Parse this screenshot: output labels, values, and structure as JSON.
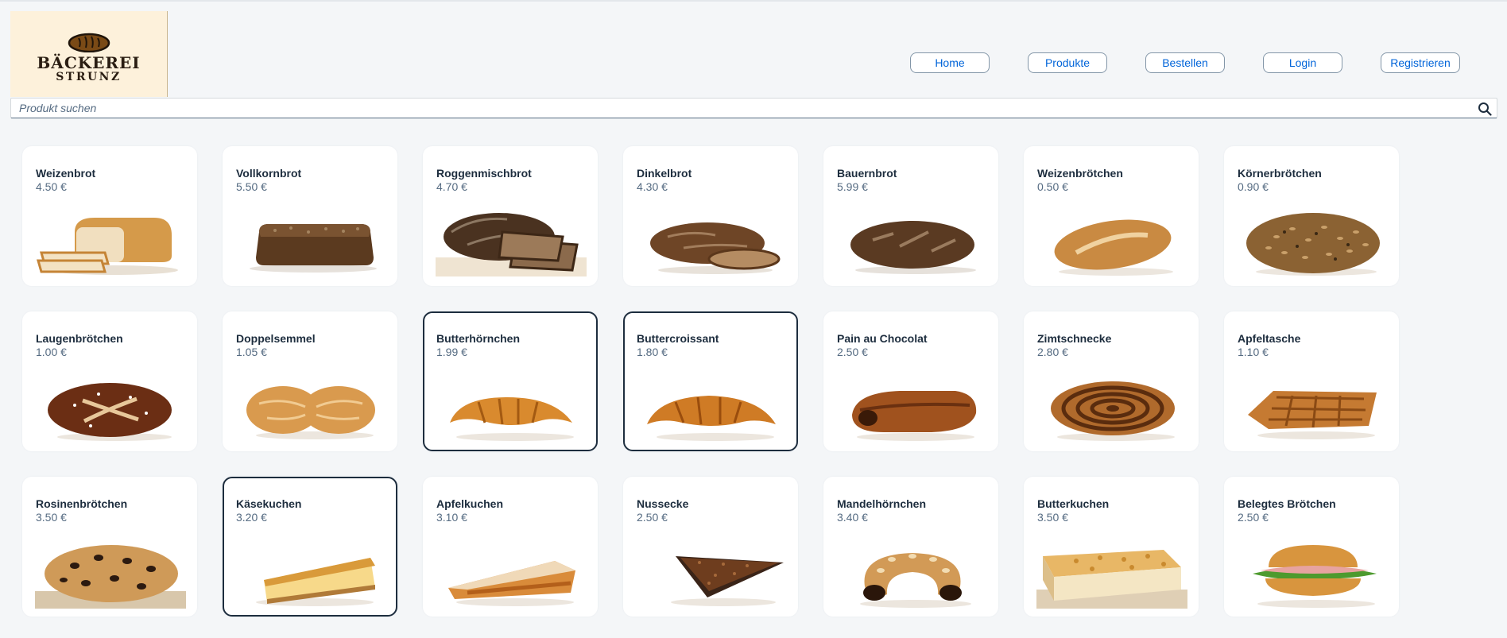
{
  "brand": {
    "line1": "BÄCKEREI",
    "line2": "STRUNZ"
  },
  "nav": [
    {
      "label": "Home"
    },
    {
      "label": "Produkte"
    },
    {
      "label": "Bestellen"
    },
    {
      "label": "Login"
    },
    {
      "label": "Registrieren"
    }
  ],
  "search": {
    "placeholder": "Produkt suchen",
    "icon": "search-icon"
  },
  "products": [
    {
      "name": "Weizenbrot",
      "price": "4.50 €",
      "image": "sliced-white-bread"
    },
    {
      "name": "Vollkornbrot",
      "price": "5.50 €",
      "image": "wholegrain-loaf"
    },
    {
      "name": "Roggenmischbrot",
      "price": "4.70 €",
      "image": "rye-bread"
    },
    {
      "name": "Dinkelbrot",
      "price": "4.30 €",
      "image": "spelt-bread"
    },
    {
      "name": "Bauernbrot",
      "price": "5.99 €",
      "image": "farmer-bread"
    },
    {
      "name": "Weizenbrötchen",
      "price": "0.50 €",
      "image": "wheat-roll"
    },
    {
      "name": "Körnerbrötchen",
      "price": "0.90 €",
      "image": "seed-roll"
    },
    {
      "name": "Laugenbrötchen",
      "price": "1.00 €",
      "image": "pretzel-roll"
    },
    {
      "name": "Doppelsemmel",
      "price": "1.05 €",
      "image": "double-roll"
    },
    {
      "name": "Butterhörnchen",
      "price": "1.99 €",
      "image": "croissant",
      "selected": true
    },
    {
      "name": "Buttercroissant",
      "price": "1.80 €",
      "image": "croissant",
      "selected": true
    },
    {
      "name": "Pain au Chocolat",
      "price": "2.50 €",
      "image": "pain-au-chocolat"
    },
    {
      "name": "Zimtschnecke",
      "price": "2.80 €",
      "image": "cinnamon-roll"
    },
    {
      "name": "Apfeltasche",
      "price": "1.10 €",
      "image": "apple-turnover"
    },
    {
      "name": "Rosinenbrötchen",
      "price": "3.50 €",
      "image": "raisin-roll"
    },
    {
      "name": "Käsekuchen",
      "price": "3.20 €",
      "image": "cheesecake",
      "selected": true
    },
    {
      "name": "Apfelkuchen",
      "price": "3.10 €",
      "image": "apple-cake"
    },
    {
      "name": "Nussecke",
      "price": "2.50 €",
      "image": "nut-corner"
    },
    {
      "name": "Mandelhörnchen",
      "price": "3.40 €",
      "image": "almond-horn"
    },
    {
      "name": "Butterkuchen",
      "price": "3.50 €",
      "image": "butter-cake"
    },
    {
      "name": "Belegtes Brötchen",
      "price": "2.50 €",
      "image": "sandwich"
    }
  ],
  "colors": {
    "accent": "#0064d9",
    "text": "#1d2d3e",
    "muted": "#556b82",
    "background": "#f4f6f8"
  }
}
